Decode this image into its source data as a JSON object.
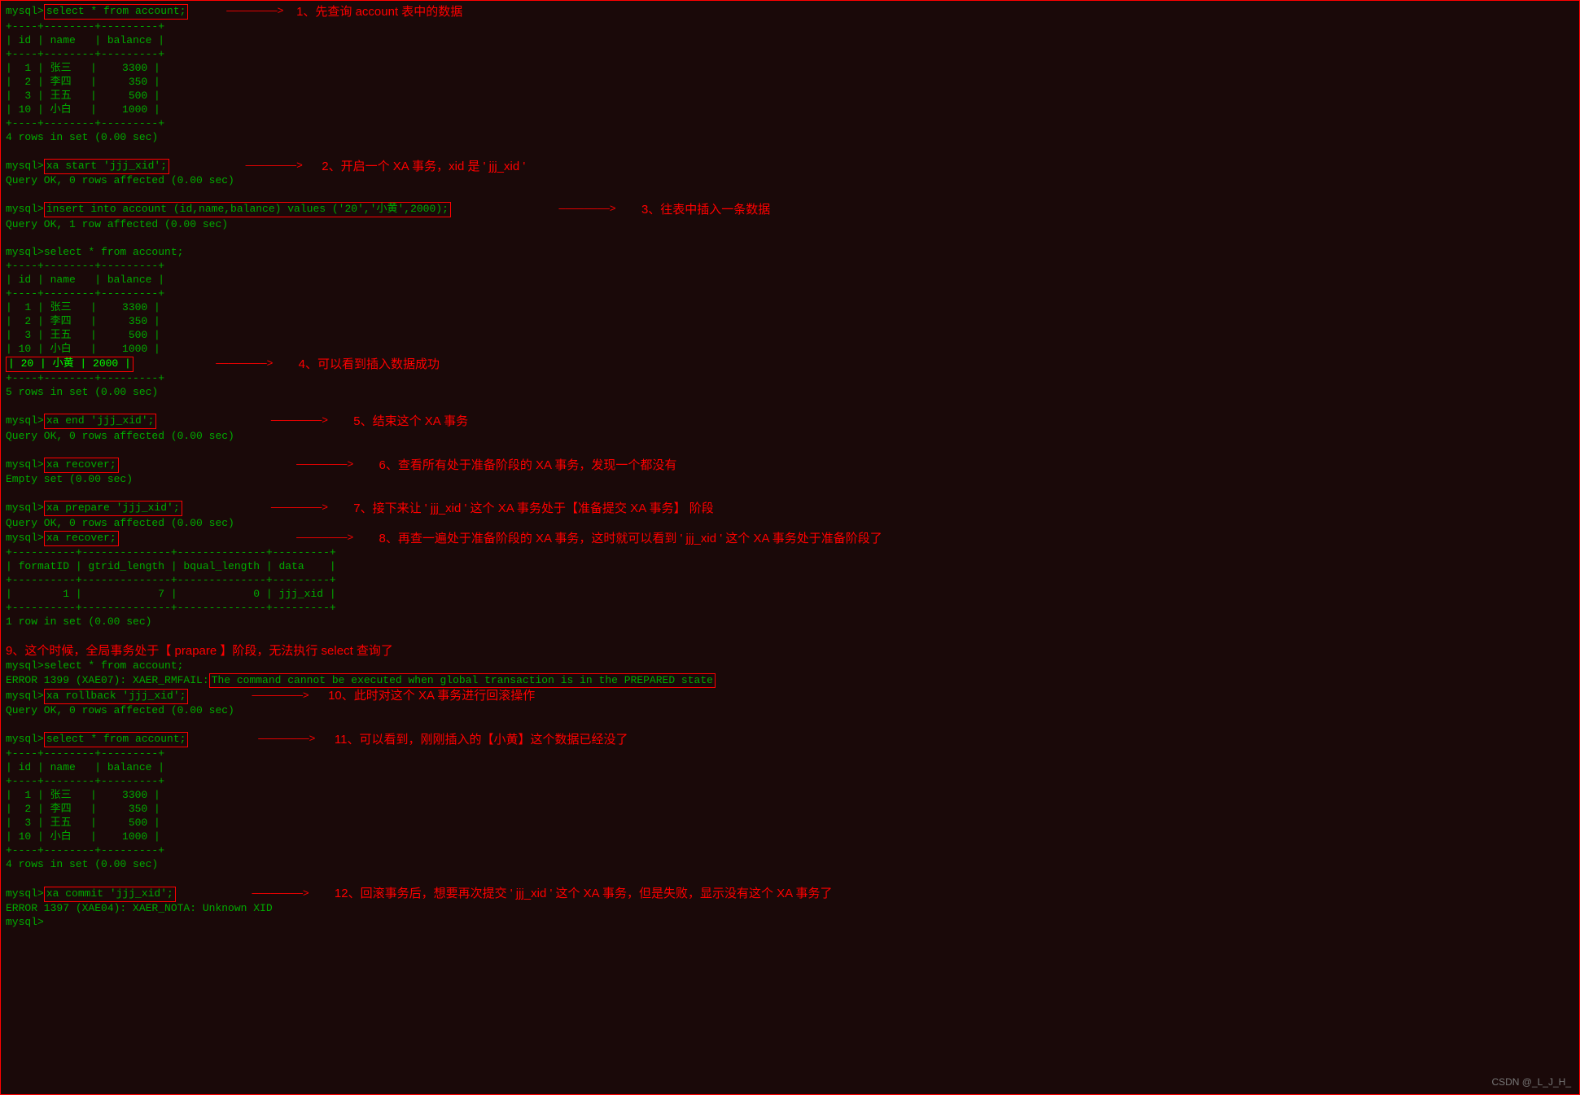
{
  "prompt": "mysql>",
  "queries": {
    "q1": " select * from account; ",
    "q2": " xa start 'jjj_xid'; ",
    "q3": " insert into account (id,name,balance) values ('20','小黄',2000); ",
    "q4": "select * from account;",
    "q5": " xa end 'jjj_xid'; ",
    "q6": " xa recover; ",
    "q7": " xa prepare 'jjj_xid'; ",
    "q8": " xa recover; ",
    "q9": "select * from account;",
    "q10": " xa rollback 'jjj_xid'; ",
    "q11": " select * from account; ",
    "q12": " xa commit 'jjj_xid'; "
  },
  "annotations": {
    "a1": "1、先查询 account 表中的数据",
    "a2": "2、开启一个 XA 事务，xid 是 ' jjj_xid '",
    "a3": "3、往表中插入一条数据",
    "a4": "4、可以看到插入数据成功",
    "a5": "5、结束这个 XA 事务",
    "a6": "6、查看所有处于准备阶段的 XA 事务，发现一个都没有",
    "a7": "7、接下来让 ' jjj_xid ' 这个 XA 事务处于【准备提交 XA 事务】 阶段",
    "a8": "8、再查一遍处于准备阶段的 XA 事务，这时就可以看到 ' jjj_xid ' 这个 XA 事务处于准备阶段了",
    "a9": "9、这个时候，全局事务处于【 prapare 】阶段，无法执行 select 查询了",
    "a10": "10、此时对这个 XA 事务进行回滚操作",
    "a11": "11、可以看到，刚刚插入的【小黄】这个数据已经没了",
    "a12": "12、回滚事务后，想要再次提交 ' jjj_xid ' 这个 XA 事务，但是失败，显示没有这个 XA 事务了"
  },
  "tables": {
    "border": "+----+--------+---------+",
    "header": "| id | name   | balance |",
    "rows": {
      "r1": "|  1 | 张三   |    3300 |",
      "r2": "|  2 | 李四   |     350 |",
      "r3": "|  3 | 王五   |     500 |",
      "r4": "| 10 | 小白   |    1000 |",
      "r5_boxed": "| 20 | 小黄   |    2000 |"
    },
    "recover_border": "+----------+--------------+--------------+---------+",
    "recover_header": "| formatID | gtrid_length | bqual_length | data    |",
    "recover_row": "|        1 |            7 |            0 | jjj_xid |"
  },
  "results": {
    "four_rows": "4 rows in set (0.00 sec)",
    "five_rows": "5 rows in set (0.00 sec)",
    "one_row": "1 row in set (0.00 sec)",
    "ok_zero": "Query OK, 0 rows affected (0.00 sec)",
    "ok_one": "Query OK, 1 row affected (0.00 sec)",
    "empty_set": "Empty set (0.00 sec)"
  },
  "errors": {
    "err1399_prefix": "ERROR 1399 (XAE07): XAER_RMFAIL:",
    "err1399_msg": " The command cannot be executed when global transaction is in the  PREPARED state ",
    "err1397": "ERROR 1397 (XAE04): XAER_NOTA: Unknown XID"
  },
  "arrow": "  ————————>  ",
  "arrow_long": "      ————————>  ",
  "watermark": "CSDN @_L_J_H_"
}
